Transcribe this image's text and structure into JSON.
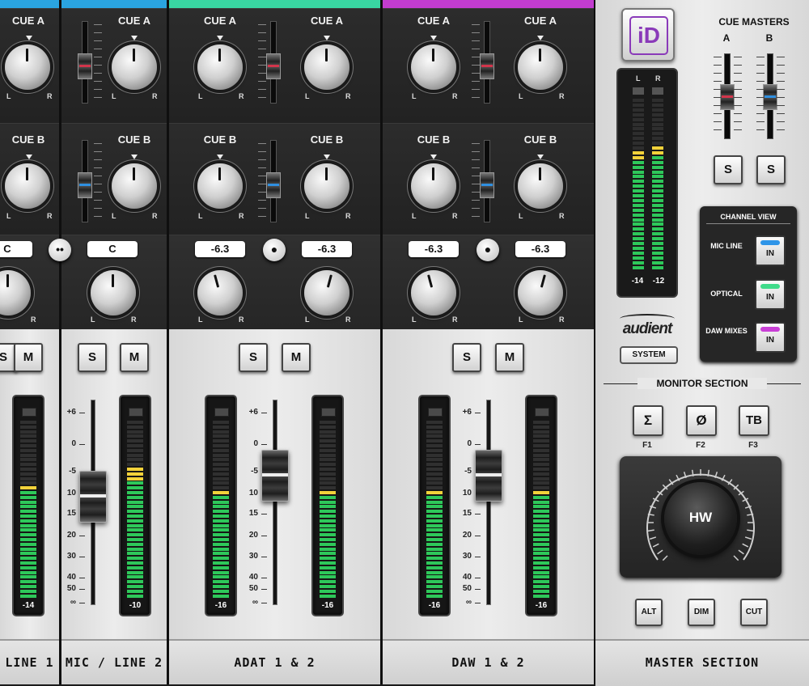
{
  "colors": {
    "strip1": "#2aa4e0",
    "strip2": "#2aa4e0",
    "adat": "#39d6a2",
    "daw": "#c23ccf",
    "cue_a_cap": "#d2354b",
    "cue_b_cap": "#2f8fe0",
    "mic_line_led": "#2f95e8",
    "optical_led": "#3fdb8a",
    "daw_led": "#c93fd6"
  },
  "cue_a_label": "CUE A",
  "cue_b_label": "CUE B",
  "knob_l": "L",
  "knob_r": "R",
  "solo_label": "S",
  "mute_label": "M",
  "fader_scale": [
    "+6",
    "0",
    "-5",
    "10",
    "15",
    "20",
    "30",
    "40",
    "50",
    "∞"
  ],
  "strips": [
    {
      "name": "LINE 1",
      "pan": "C",
      "meter": "-14"
    },
    {
      "name": "MIC / LINE 2",
      "pan": "C",
      "meter": "-10"
    },
    {
      "name": "ADAT 1 & 2",
      "pan_l": "-6.3",
      "pan_r": "-6.3",
      "meter_l": "-16",
      "meter_r": "-16"
    },
    {
      "name": "DAW 1 & 2",
      "pan_l": "-6.3",
      "pan_r": "-6.3",
      "meter_l": "-16",
      "meter_r": "-16"
    }
  ],
  "link_icon": "chain-link-icon",
  "master": {
    "logo": "iD",
    "meter_left": "-14",
    "meter_right": "-12",
    "meter_l_label": "L",
    "meter_r_label": "R",
    "brand": "audient",
    "system_button": "SYSTEM",
    "cue_masters_title": "CUE MASTERS",
    "cue_master_a": "A",
    "cue_master_b": "B",
    "channel_view_title": "CHANNEL VIEW",
    "channel_view": [
      {
        "label": "MIC LINE",
        "button": "IN"
      },
      {
        "label": "OPTICAL",
        "button": "IN"
      },
      {
        "label": "DAW MIXES",
        "button": "IN"
      }
    ],
    "monitor_section_title": "MONITOR SECTION",
    "function_keys": [
      {
        "symbol": "Σ",
        "label": "F1",
        "icon": "sum-icon"
      },
      {
        "symbol": "Ø",
        "label": "F2",
        "icon": "phase-icon"
      },
      {
        "symbol": "TB",
        "label": "F3",
        "icon": "talkback-icon"
      }
    ],
    "encoder_label": "HW",
    "bottom_buttons": [
      "ALT",
      "DIM",
      "CUT"
    ],
    "section_name": "MASTER SECTION"
  }
}
